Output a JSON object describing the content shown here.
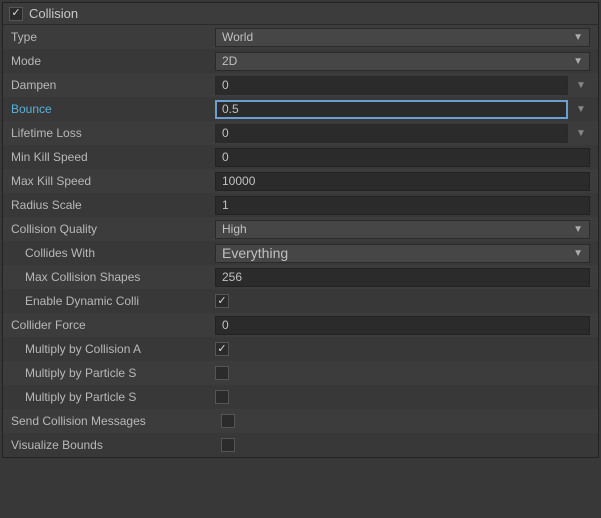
{
  "panel": {
    "title": "Collision",
    "enabled": true
  },
  "fields": {
    "type": {
      "label": "Type",
      "value": "World"
    },
    "mode": {
      "label": "Mode",
      "value": "2D"
    },
    "dampen": {
      "label": "Dampen",
      "value": "0"
    },
    "bounce": {
      "label": "Bounce",
      "value": "0.5"
    },
    "lifetimeLoss": {
      "label": "Lifetime Loss",
      "value": "0"
    },
    "minKillSpeed": {
      "label": "Min Kill Speed",
      "value": "0"
    },
    "maxKillSpeed": {
      "label": "Max Kill Speed",
      "value": "10000"
    },
    "radiusScale": {
      "label": "Radius Scale",
      "value": "1"
    },
    "collisionQuality": {
      "label": "Collision Quality",
      "value": "High"
    },
    "collidesWith": {
      "label": "Collides With",
      "value": "Everything"
    },
    "maxCollisionShapes": {
      "label": "Max Collision Shapes",
      "value": "256"
    },
    "enableDynamicColliders": {
      "label": "Enable Dynamic Colli"
    },
    "colliderForce": {
      "label": "Collider Force",
      "value": "0"
    },
    "multiplyByCollisionAngle": {
      "label": "Multiply by Collision A"
    },
    "multiplyByParticleSpeed": {
      "label": "Multiply by Particle S"
    },
    "multiplyByParticleSize": {
      "label": "Multiply by Particle S"
    },
    "sendCollisionMessages": {
      "label": "Send Collision Messages"
    },
    "visualizeBounds": {
      "label": "Visualize Bounds"
    }
  }
}
